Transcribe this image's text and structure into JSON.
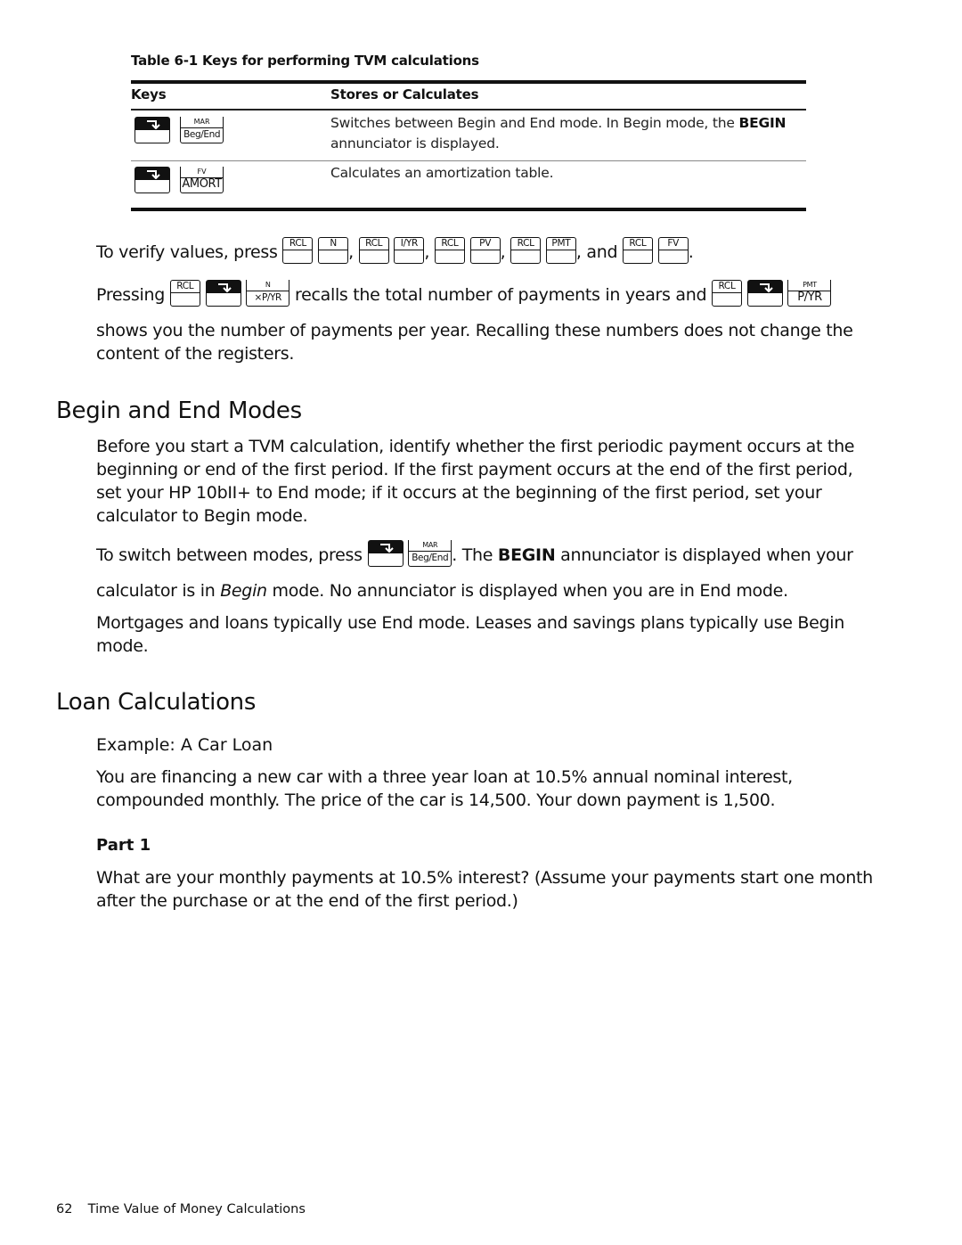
{
  "table": {
    "caption": "Table 6-1  Keys for performing TVM calculations",
    "headers": [
      "Keys",
      "Stores or Calculates"
    ],
    "rows": [
      {
        "keys": [
          {
            "type": "shift",
            "icon": "shift-arrow-icon"
          },
          {
            "type": "fn",
            "top": "MAR",
            "label": "Beg/End"
          }
        ],
        "description_parts": [
          "Switches between Begin and End mode. In Begin mode, the ",
          "BEGIN",
          " annunciator is displayed."
        ]
      },
      {
        "keys": [
          {
            "type": "shift",
            "icon": "shift-arrow-icon"
          },
          {
            "type": "fn",
            "top": "FV",
            "label": "AMORT"
          }
        ],
        "description_parts": [
          "Calculates an amortization table."
        ]
      }
    ]
  },
  "verify": {
    "prefix": "To verify values, press",
    "pairs": [
      [
        "RCL",
        "N"
      ],
      [
        "RCL",
        "I/YR"
      ],
      [
        "RCL",
        "PV"
      ],
      [
        "RCL",
        "PMT"
      ],
      [
        "RCL",
        "FV"
      ]
    ],
    "sep": ",",
    "and": ", and",
    "end": "."
  },
  "pressing": {
    "prefix": "Pressing",
    "key1": {
      "label": "RCL"
    },
    "key2_fn": {
      "top": "N",
      "label": "×P/YR"
    },
    "middle": "recalls the total number of payments in years and",
    "key3": {
      "label": "RCL"
    },
    "key4_fn": {
      "top": "PMT",
      "label": "P/YR"
    },
    "continuation": "shows you the number of payments per year. Recalling these numbers does not change the",
    "continuation2": "content of the registers."
  },
  "section1": {
    "heading": "Begin and End Modes",
    "para1": [
      "Before you start a TVM calculation, identify whether the first periodic payment occurs at the",
      "beginning or end of the first period. If the first payment occurs at the end of the first period,",
      "set your HP 10bII+ to End mode; if it occurs at the beginning of the first period, set your",
      "calculator to Begin mode."
    ],
    "switch": {
      "prefix": "To switch between modes, press",
      "fn_top": "MAR",
      "fn_label": "Beg/End",
      "after1": ". The ",
      "bold": "BEGIN",
      "after2": " annunciator is displayed when your",
      "line2_a": "calculator is in ",
      "line2_italic": "Begin",
      "line2_b": " mode. No annunciator is displayed when you are in End mode."
    },
    "para3": [
      "Mortgages and loans typically use End mode. Leases and savings plans typically use Begin",
      "mode."
    ]
  },
  "section2": {
    "heading": "Loan Calculations",
    "example_title": "Example: A Car Loan",
    "example_text": [
      "You are financing a new car with a three year loan at 10.5% annual nominal interest,",
      "compounded monthly. The price of the car is 14,500. Your down payment is 1,500."
    ],
    "part_title": "Part 1",
    "part_text": [
      "What are your monthly payments at 10.5% interest? (Assume your payments start one month",
      "after the purchase or at the end of the first period.)"
    ]
  },
  "footer": {
    "page_number": "62",
    "chapter": "Time Value of Money Calculations"
  }
}
